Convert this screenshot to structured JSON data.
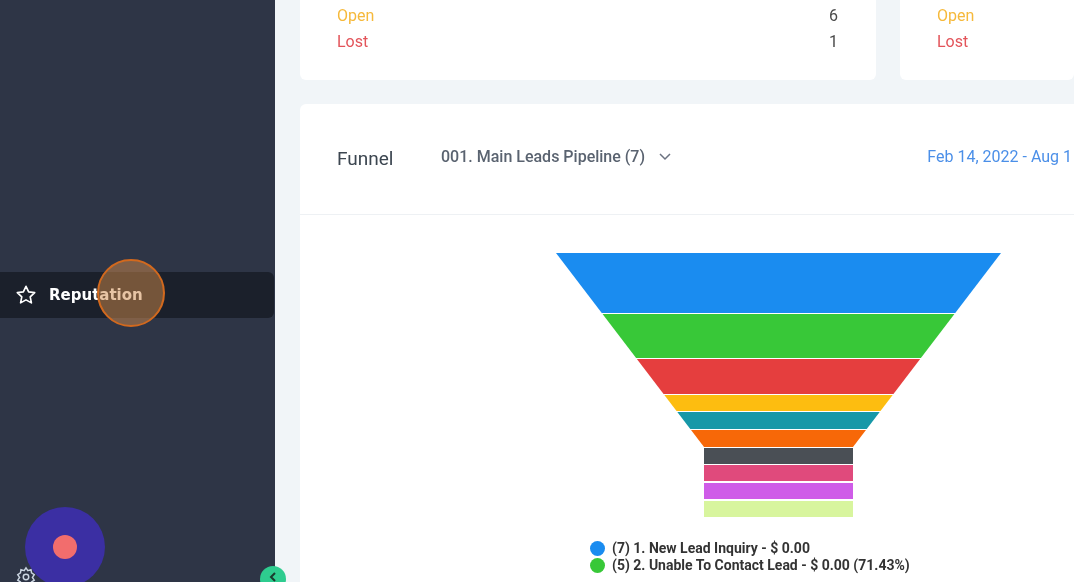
{
  "sidebar": {
    "items": [
      {
        "label": "Reputation",
        "selected": true
      }
    ]
  },
  "summary_cards": [
    {
      "rows": [
        {
          "label": "Open",
          "value": "6",
          "color": "#f6b93b"
        },
        {
          "label": "Lost",
          "value": "1",
          "color": "#e3545a"
        }
      ]
    },
    {
      "rows": [
        {
          "label": "Open",
          "color": "#f6b93b"
        },
        {
          "label": "Lost",
          "color": "#e3545a"
        }
      ]
    }
  ],
  "funnel": {
    "title": "Funnel",
    "pipeline": "001. Main Leads Pipeline (7)",
    "date_range": "Feb 14, 2022 - Aug 1",
    "legend": [
      {
        "label": "(7) 1. New Lead Inquiry - $ 0.00",
        "color": "#1a8cf0"
      },
      {
        "label": "(5) 2. Unable To Contact Lead - $ 0.00 (71.43%)",
        "color": "#38c838"
      }
    ]
  }
}
